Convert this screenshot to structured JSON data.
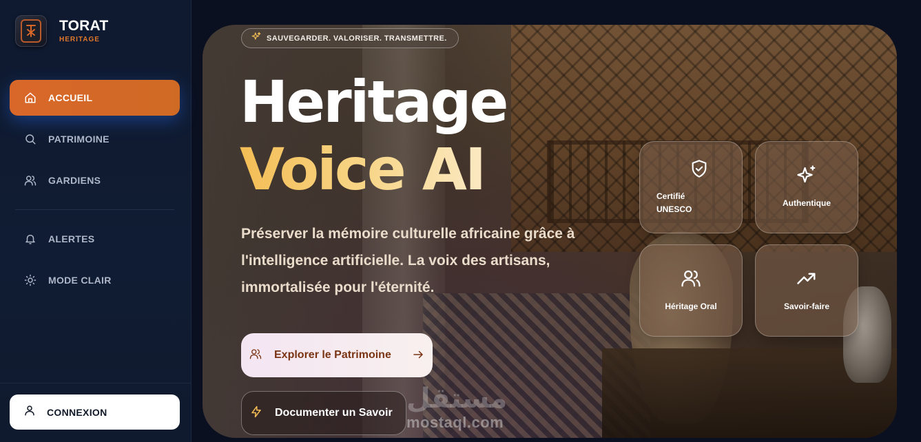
{
  "brand": {
    "name": "TORAT",
    "subtitle": "HERITAGE"
  },
  "sidebar": {
    "items": [
      {
        "label": "ACCUEIL",
        "icon": "home-icon",
        "active": true
      },
      {
        "label": "PATRIMOINE",
        "icon": "search-icon",
        "active": false
      },
      {
        "label": "GARDIENS",
        "icon": "users-icon",
        "active": false
      },
      {
        "label": "ALERTES",
        "icon": "bell-icon",
        "active": false
      },
      {
        "label": "MODE CLAIR",
        "icon": "sun-icon",
        "active": false
      }
    ],
    "login_label": "CONNEXION"
  },
  "hero": {
    "tagline": "SAUVEGARDER. VALORISER. TRANSMETTRE.",
    "title_line1": "Heritage",
    "title_line2": "Voice AI",
    "description": "Préserver la mémoire culturelle africaine grâce à l'intelligence artificielle. La voix des artisans, immortalisée pour l'éternité.",
    "primary_button": "Explorer le Patrimoine",
    "secondary_button": "Documenter un Savoir",
    "features": [
      {
        "label": "Certifié UNESCO",
        "icon": "shield-check-icon"
      },
      {
        "label": "Authentique",
        "icon": "sparkles-icon"
      },
      {
        "label": "Héritage Oral",
        "icon": "users-icon"
      },
      {
        "label": "Savoir-faire",
        "icon": "trending-up-icon"
      }
    ]
  },
  "watermark": {
    "text": "mostaql.com",
    "arabic": "مستقل"
  },
  "colors": {
    "accent": "#d9672a",
    "gold": "#f4bd55",
    "sidebar_bg": "#0f1a30"
  }
}
